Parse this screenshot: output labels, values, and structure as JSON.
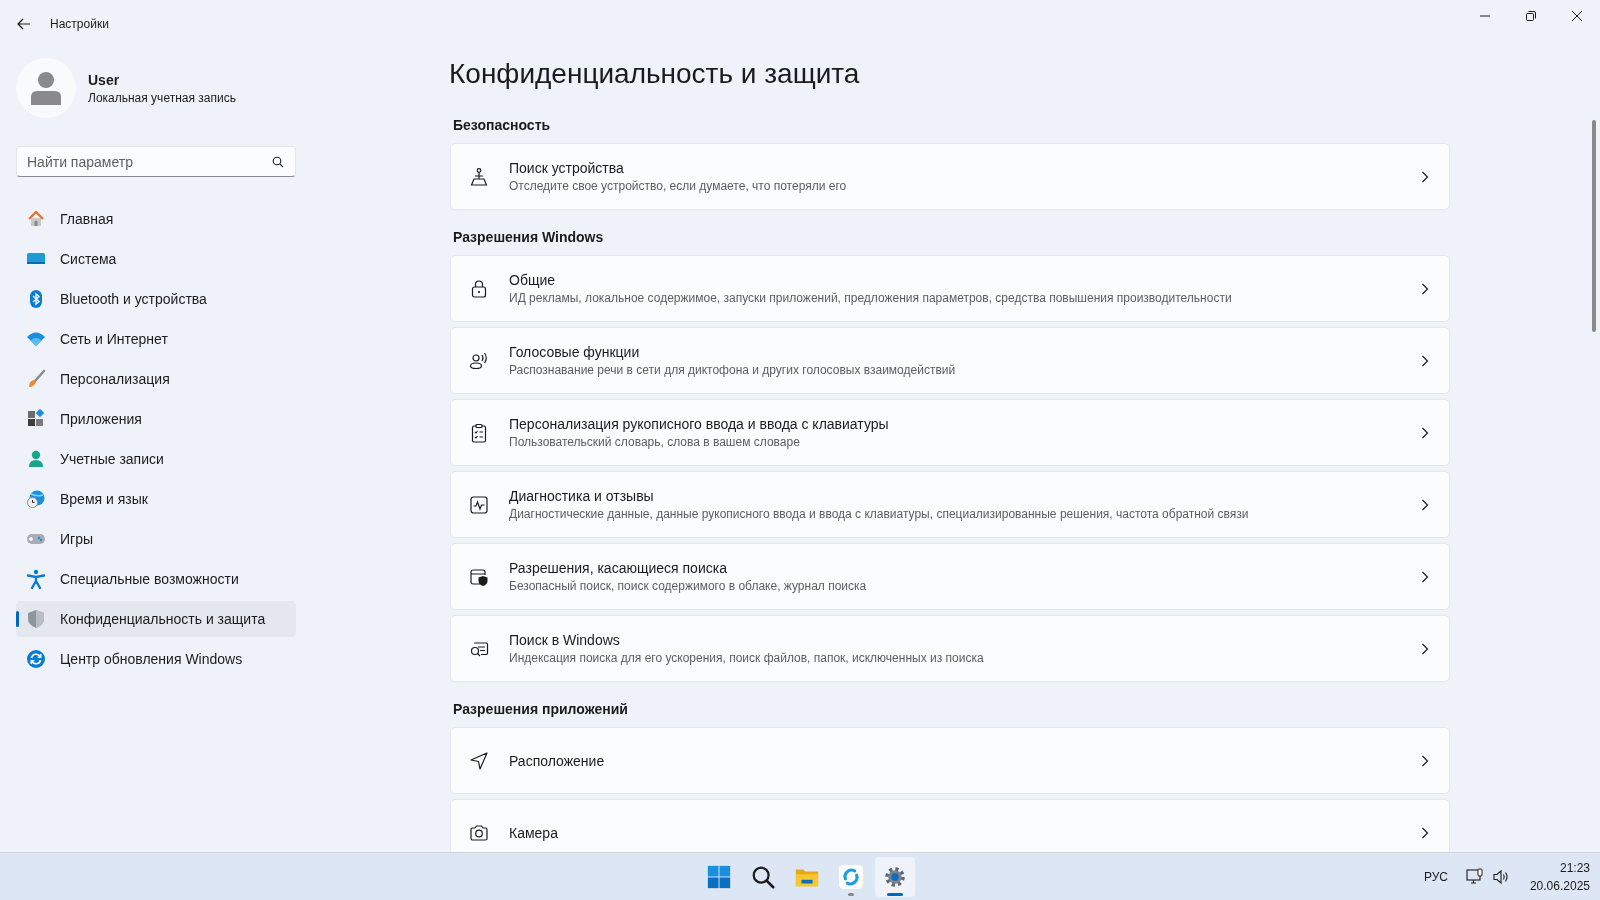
{
  "window": {
    "title": "Настройки"
  },
  "account": {
    "name": "User",
    "type": "Локальная учетная запись"
  },
  "search": {
    "placeholder": "Найти параметр"
  },
  "sidebar": {
    "items": [
      {
        "label": "Главная",
        "selected": false
      },
      {
        "label": "Система",
        "selected": false
      },
      {
        "label": "Bluetooth и устройства",
        "selected": false
      },
      {
        "label": "Сеть и Интернет",
        "selected": false
      },
      {
        "label": "Персонализация",
        "selected": false
      },
      {
        "label": "Приложения",
        "selected": false
      },
      {
        "label": "Учетные записи",
        "selected": false
      },
      {
        "label": "Время и язык",
        "selected": false
      },
      {
        "label": "Игры",
        "selected": false
      },
      {
        "label": "Специальные возможности",
        "selected": false
      },
      {
        "label": "Конфиденциальность и защита",
        "selected": true
      },
      {
        "label": "Центр обновления Windows",
        "selected": false
      }
    ]
  },
  "page": {
    "title": "Конфиденциальность и защита",
    "sections": [
      {
        "heading": "Безопасность",
        "items": [
          {
            "title": "Поиск устройства",
            "description": "Отследите свое устройство, если думаете, что потеряли его"
          }
        ]
      },
      {
        "heading": "Разрешения Windows",
        "items": [
          {
            "title": "Общие",
            "description": "ИД рекламы, локальное содержимое, запуски приложений, предложения параметров, средства повышения производительности"
          },
          {
            "title": "Голосовые функции",
            "description": "Распознавание речи в сети для диктофона и других голосовых взаимодействий"
          },
          {
            "title": "Персонализация рукописного ввода и ввода с клавиатуры",
            "description": "Пользовательский словарь, слова в вашем словаре"
          },
          {
            "title": "Диагностика и отзывы",
            "description": "Диагностические данные, данные рукописного ввода и ввода с клавиатуры, специализированные решения, частота обратной связи"
          },
          {
            "title": "Разрешения, касающиеся поиска",
            "description": "Безопасный поиск, поиск содержимого в облаке, журнал поиска"
          },
          {
            "title": "Поиск в Windows",
            "description": "Индексация поиска для его ускорения, поиск файлов, папок, исключенных из поиска"
          }
        ]
      },
      {
        "heading": "Разрешения приложений",
        "items": [
          {
            "title": "Расположение"
          },
          {
            "title": "Камера"
          }
        ]
      }
    ]
  },
  "taskbar": {
    "apps": [
      {
        "selected": false,
        "running": false
      },
      {
        "selected": false,
        "running": false
      },
      {
        "selected": false,
        "running": false
      },
      {
        "selected": false,
        "running": true
      },
      {
        "selected": true,
        "running": true
      }
    ],
    "language": "РУС",
    "time": "21:23",
    "date": "20.06.2025"
  }
}
